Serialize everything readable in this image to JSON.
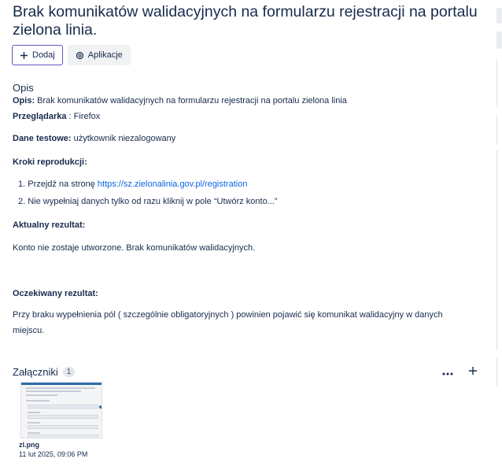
{
  "issue": {
    "title": "Brak komunikatów walidacyjnych na formularzu rejestracji na portalu zielona linia."
  },
  "toolbar": {
    "add_label": "Dodaj",
    "apps_label": "Aplikacje"
  },
  "description": {
    "heading": "Opis",
    "opis_label": "Opis:",
    "opis_value": " Brak komunikatów walidacyjnych na formularzu rejestracji na portalu zielona linia",
    "browser_label": "Przeglądarka",
    "browser_value": " : Firefox",
    "testdata_label": "Dane testowe:",
    "testdata_value": " użytkownik niezalogowany",
    "steps_label": "Kroki reprodukcji:",
    "step1_prefix": "1. Przejdź na stronę ",
    "step1_link": "https://sz.zielonalinia.gov.pl/registration",
    "step2": "2. Nie wypełniaj danych tylko od razu kliknij w pole “Utwórz konto...”",
    "actual_label": "Aktualny rezultat:",
    "actual_value": "Konto nie zostaje utworzone. Brak komunikatów walidacyjnych.",
    "expected_label": "Oczekiwany rezultat:",
    "expected_value": "Przy braku wypełnienia pól ( szczególnie obligatoryjnych ) powinien pojawić się komunikat walidacyjny w danych miejscu."
  },
  "attachments": {
    "heading": "Załączniki",
    "count": "1",
    "items": [
      {
        "name": "zl.png",
        "date": "11 lut 2025, 09:06 PM"
      }
    ]
  },
  "colors": {
    "accent": "#6554c0",
    "link": "#0c66e4",
    "text": "#172b4d"
  }
}
